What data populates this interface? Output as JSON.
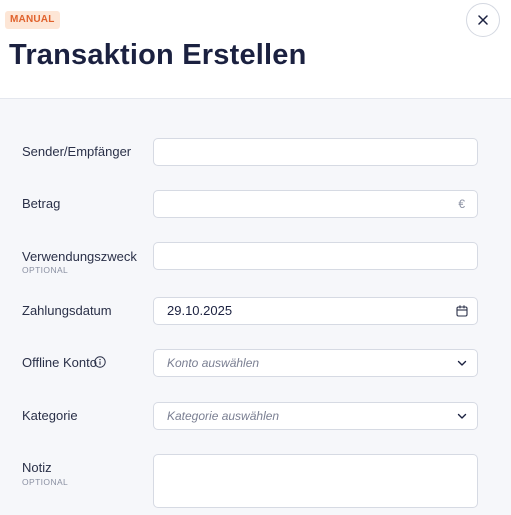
{
  "header": {
    "badge": "MANUAL",
    "title": "Transaktion Erstellen",
    "close_icon": "close-icon"
  },
  "form": {
    "sender": {
      "label": "Sender/Empfänger",
      "value": ""
    },
    "amount": {
      "label": "Betrag",
      "value": "",
      "currency": "€"
    },
    "purpose": {
      "label": "Verwendungszweck",
      "sublabel": "OPTIONAL",
      "value": ""
    },
    "payment_date": {
      "label": "Zahlungsdatum",
      "value": "29.10.2025",
      "icon": "calendar-icon"
    },
    "offline_account": {
      "label": "Offline Konto",
      "info_icon": "info-icon",
      "placeholder": "Konto auswählen",
      "icon": "chevron-down-icon"
    },
    "category": {
      "label": "Kategorie",
      "placeholder": "Kategorie auswählen",
      "icon": "chevron-down-icon"
    },
    "note": {
      "label": "Notiz",
      "sublabel": "OPTIONAL",
      "value": ""
    }
  },
  "colors": {
    "title": "#1b2140",
    "badge_bg": "#fde6d6",
    "badge_text": "#e0622c",
    "form_bg": "#f6f7fa",
    "field_border": "#d6dae3"
  }
}
